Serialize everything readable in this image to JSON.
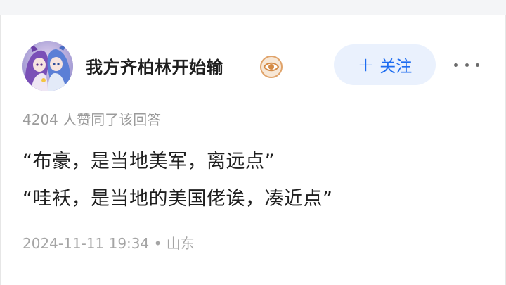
{
  "author": {
    "name": "我方齐柏林开始输",
    "badge_icon": "eye-icon",
    "avatar_icon": "anime-avatar"
  },
  "follow_button": {
    "icon": "plus-icon",
    "plus_glyph": "+",
    "label": "关注"
  },
  "more_button": {
    "icon": "more-dots-icon"
  },
  "answer": {
    "likes_text": "4204 人赞同了该回答",
    "lines": [
      "“布豪，是当地美军，离远点”",
      "“哇袄，是当地的美国佬诶，凑近点”"
    ],
    "timestamp": "2024-11-11 19:34",
    "separator": "•",
    "location": "山东"
  },
  "colors": {
    "accent": "#1d6cf0",
    "follow_bg": "#eaf1fd",
    "text": "#1f1f1f",
    "muted": "#9b9b9b",
    "badge": "#e0a36a"
  }
}
